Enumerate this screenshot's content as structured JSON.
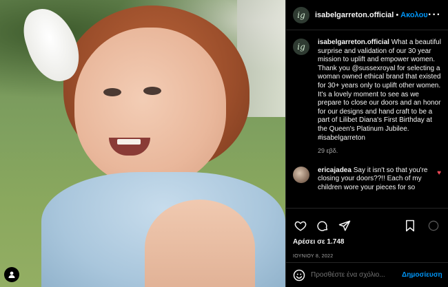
{
  "post": {
    "username": "isabelgarreton.official",
    "avatar_text": "ig",
    "follow_label": "Ακολουθήστε",
    "more_label": "···",
    "caption_user": "isabelgarreton.official",
    "caption_text": " What a beautiful surprise and validation of our 30 year mission to uplift and empower women. Thank you @sussexroyal for selecting a woman owned ethical brand that existed for 30+ years only to uplift other women. It's a lovely moment to see as we prepare to close our doors and an honor for our designs and hand craft to be a part of Lilibet Diana's First Birthday at the Queen's Platinum Jubilee.",
    "caption_hashtag": "#isabelgarreton",
    "caption_age": "29 εβδ.",
    "comments": [
      {
        "user": "ericajadea",
        "text": " Say it isn't so that you're closing your doors??!! Each of my children wore your pieces for so"
      }
    ],
    "likes_label": "Αρέσει σε 1.748",
    "date_label": "ΙΟΥΝΙΟΥ 8, 2022",
    "comment_placeholder": "Προσθέστε ένα σχόλιο...",
    "post_button": "Δημοσίευση"
  },
  "icons": {
    "like": "heart-icon",
    "comment": "comment-icon",
    "share": "share-icon",
    "save": "bookmark-icon",
    "emoji": "emoji-icon",
    "user_tag": "user-tag-icon"
  },
  "colors": {
    "accent": "#0095f6",
    "heart": "#ed4956",
    "panel_bg": "#000000"
  }
}
